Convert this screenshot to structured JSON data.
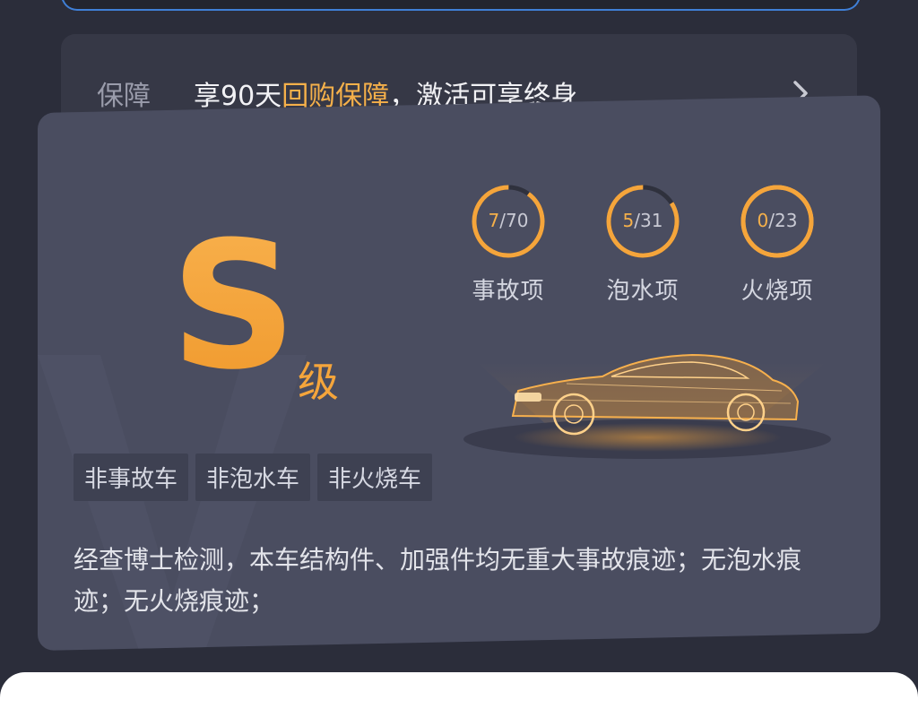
{
  "guarantee": {
    "label": "保障",
    "text_prefix": "享90天",
    "text_highlight": "回购保障",
    "text_suffix": "，激活可享终身"
  },
  "grade": {
    "letter": "S",
    "suffix": "级"
  },
  "inspections": [
    {
      "found": "7",
      "total": "/70",
      "label": "事故项",
      "progress": 0.1
    },
    {
      "found": "5",
      "total": "/31",
      "label": "泡水项",
      "progress": 0.16
    },
    {
      "found": "0",
      "total": "/23",
      "label": "火烧项",
      "progress": 0.0
    }
  ],
  "tags": [
    "非事故车",
    "非泡水车",
    "非火烧车"
  ],
  "summary": "经查博士检测，本车结构件、加强件均无重大事故痕迹；无泡水痕迹；无火烧痕迹；",
  "colors": {
    "accent": "#f5a53b",
    "card_bg": "#4a4d60",
    "page_bg": "#2b2d3a",
    "ring_track": "#2f313d"
  },
  "icons": {
    "chevron": "chevron-right-icon",
    "car": "car-wireframe-illustration",
    "watermark": "v-watermark"
  }
}
